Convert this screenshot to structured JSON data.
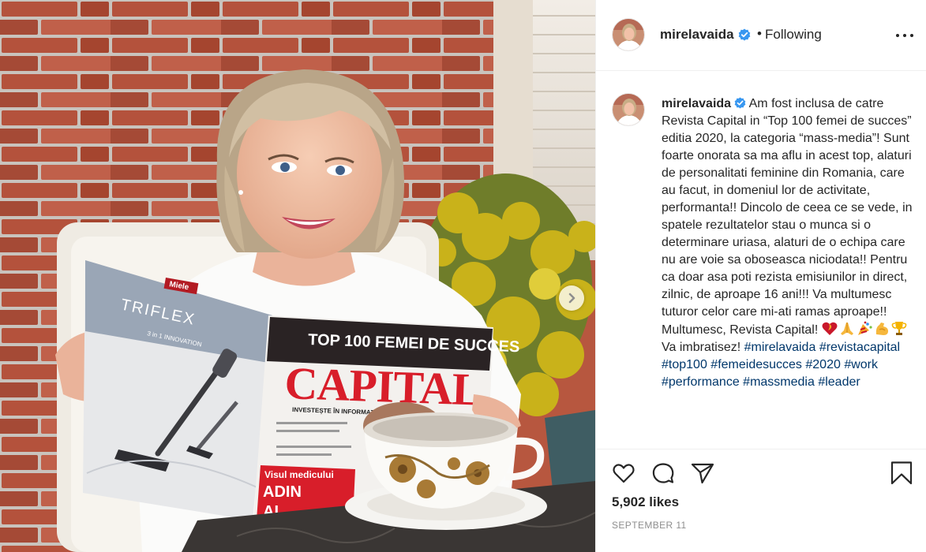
{
  "post": {
    "username": "mirelavaida",
    "separator": "•",
    "follow_state": "Following",
    "caption": "Am fost inclusa de catre Revista Capital in “Top 100 femei de succes” editia 2020, la categoria “mass-media”! Sunt foarte onorata sa ma aflu in acest top, alaturi de personalitati feminine din Romania, care au facut, in domeniul lor de activitate, performanta!! Dincolo de ceea ce se vede, in spatele rezultatelor stau o munca si o determinare uriasa, alaturi de o echipa care nu are voie sa oboseasca niciodata!! Pentru ca doar asa poti rezista emisiunilor in direct, zilnic, de aproape 16 ani!!! Va multumesc tuturor celor care mi-ati ramas aproape!! Multumesc, Revista Capital!",
    "caption_end": "Va imbratisez!",
    "emoji_icons": [
      "heart-fire-emoji",
      "praying-hands-emoji",
      "party-popper-emoji",
      "flexed-biceps-emoji",
      "trophy-emoji"
    ],
    "hashtags": [
      "#mirelavaida",
      "#revistacapital",
      "#top100",
      "#femeidesucces",
      "#2020",
      "#work",
      "#performance",
      "#massmedia",
      "#leader"
    ],
    "likes": "5,902 likes",
    "date": "SEPTEMBER 11"
  },
  "photo": {
    "magazine": {
      "headline": "TOP 100 FEMEI DE SUCCES",
      "title": "CAPITAL",
      "tagline": "INVESTEȘTE ÎN INFORMAȚII",
      "cover_bottom": "Visul medicului",
      "cover_name_1": "ADIN",
      "cover_name_2": "AL",
      "ad_brand": "Miele",
      "ad_product": "TRIFLEX",
      "ad_sub": "3 in 1 INNOVATION"
    }
  },
  "colors": {
    "verified_blue": "#3897f0",
    "hashtag_blue": "#00376b",
    "text_dark": "#262626",
    "text_gray": "#8e8e8e",
    "capital_red": "#d81e2a"
  }
}
